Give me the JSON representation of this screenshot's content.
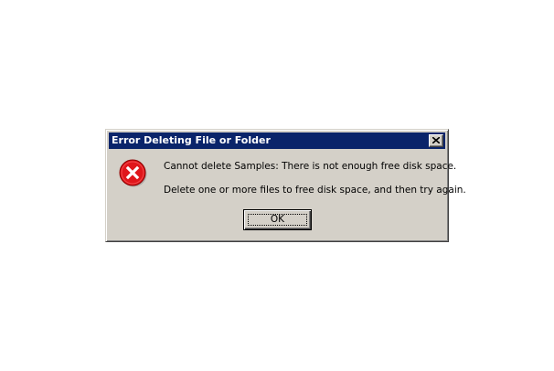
{
  "dialog": {
    "title": "Error Deleting File or Folder",
    "close_icon": "close-icon",
    "icon": "error-icon",
    "message_primary": "Cannot delete Samples: There is not enough free disk space.",
    "message_secondary": "Delete one or more files to free disk space, and then try again.",
    "ok_label": "OK"
  },
  "colors": {
    "titlebar": "#0a246a",
    "face": "#d4d0c8",
    "error_red": "#e0161b"
  }
}
